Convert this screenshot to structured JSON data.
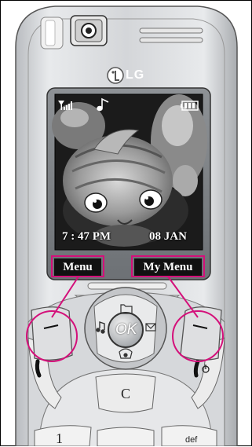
{
  "brand": {
    "name": "LG"
  },
  "screen": {
    "time": "7 : 47 PM",
    "date": "08 JAN",
    "icons": [
      "signal-icon",
      "music-note-icon",
      "battery-icon"
    ]
  },
  "softkeys": {
    "left_label": "Menu",
    "right_label": "My Menu"
  },
  "keys": {
    "ok_label": "OK",
    "clear_label": "C",
    "key1_label": "1",
    "key3_label": "def"
  },
  "colors": {
    "highlight": "#d4107a",
    "label_bg": "#111111",
    "body": "#cfd2d6"
  }
}
